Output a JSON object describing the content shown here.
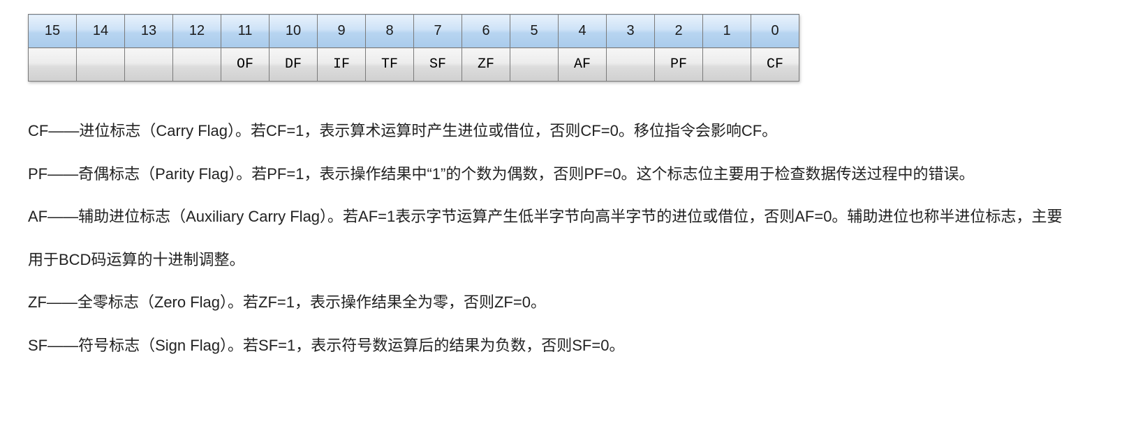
{
  "flag_register": {
    "bit_numbers": [
      "15",
      "14",
      "13",
      "12",
      "11",
      "10",
      "9",
      "8",
      "7",
      "6",
      "5",
      "4",
      "3",
      "2",
      "1",
      "0"
    ],
    "flag_names": [
      "",
      "",
      "",
      "",
      "OF",
      "DF",
      "IF",
      "TF",
      "SF",
      "ZF",
      "",
      "AF",
      "",
      "PF",
      "",
      "CF"
    ]
  },
  "descriptions": {
    "cf": "CF——进位标志（Carry Flag）。若CF=1，表示算术运算时产生进位或借位，否则CF=0。移位指令会影响CF。",
    "pf": "PF——奇偶标志（Parity Flag）。若PF=1，表示操作结果中“1”的个数为偶数，否则PF=0。这个标志位主要用于检查数据传送过程中的错误。",
    "af": "AF——辅助进位标志（Auxiliary Carry Flag）。若AF=1表示字节运算产生低半字节向高半字节的进位或借位，否则AF=0。辅助进位也称半进位标志，主要用于BCD码运算的十进制调整。",
    "zf": "ZF——全零标志（Zero Flag）。若ZF=1，表示操作结果全为零，否则ZF=0。",
    "sf": "SF——符号标志（Sign Flag）。若SF=1，表示符号数运算后的结果为负数，否则SF=0。"
  }
}
